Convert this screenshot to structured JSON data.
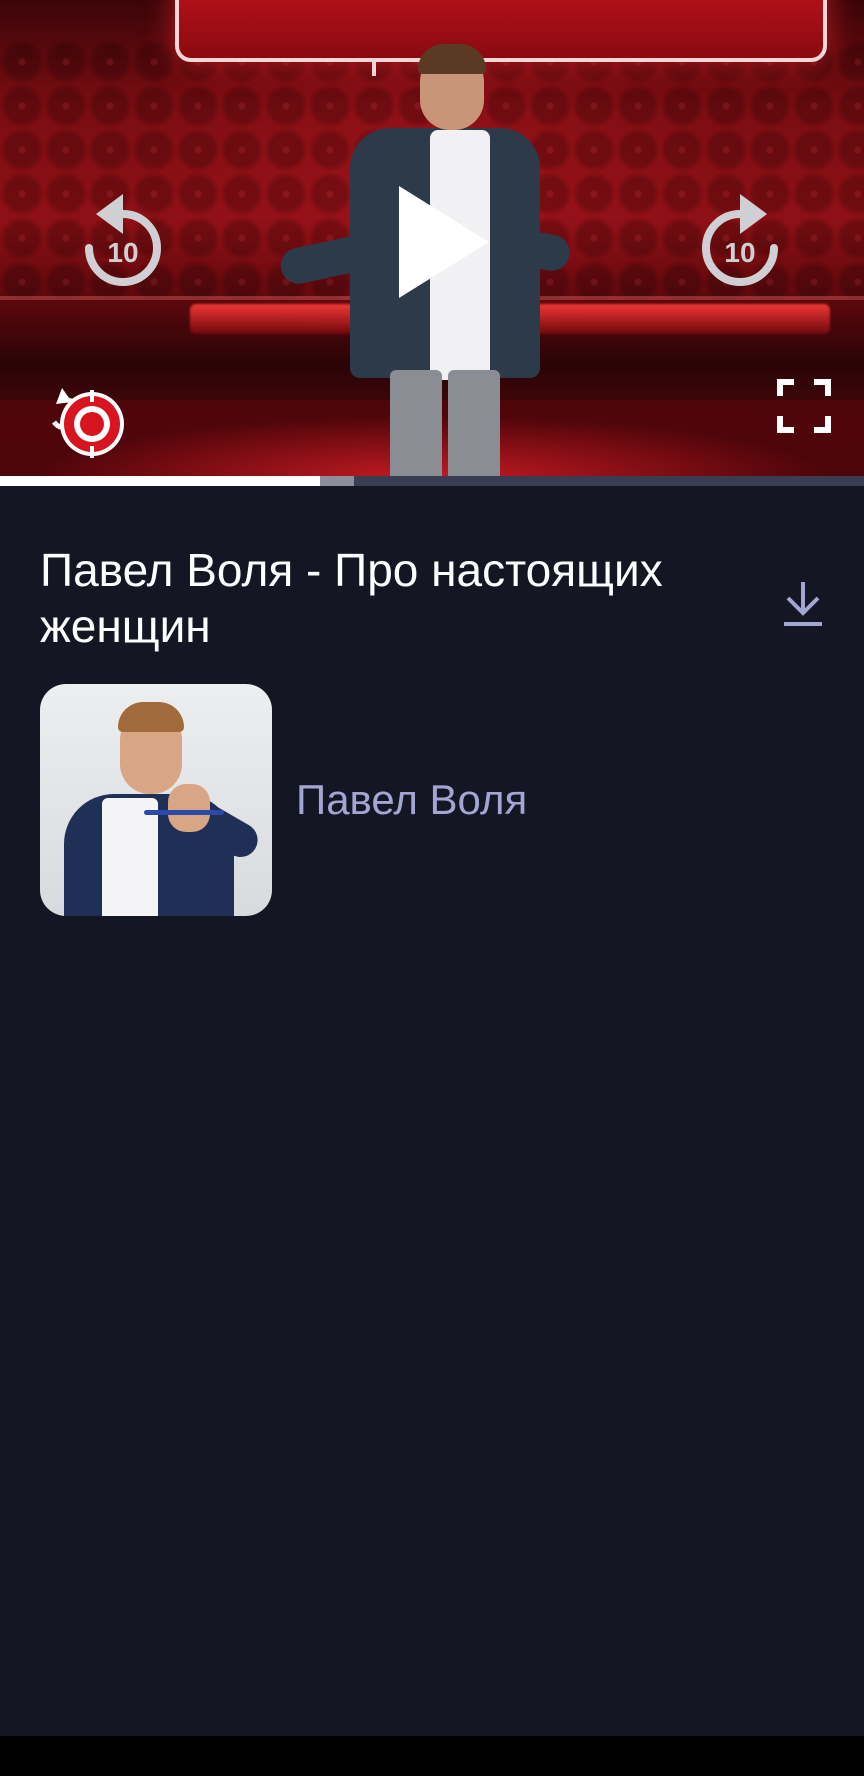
{
  "player": {
    "progress_played": 0.37,
    "progress_buffered": 0.41,
    "controls": {
      "rewind_icon": "replay-10-icon",
      "rewind_seconds": "10",
      "play_icon": "play-icon",
      "forward_icon": "forward-10-icon",
      "forward_seconds": "10",
      "fullscreen_icon": "fullscreen-icon",
      "channel_logo": "channel-logo-icon"
    }
  },
  "video": {
    "title": "Павел Воля - Про настоящих женщин",
    "download_icon": "download-icon"
  },
  "artist": {
    "name": "Павел Воля"
  },
  "colors": {
    "background": "#141624",
    "artist_name": "#a3a6d3",
    "accent_download": "#a3a6d3",
    "progress_played": "#ffffff",
    "progress_buffered": "#8c8e9a",
    "progress_track": "#3a3c52"
  }
}
